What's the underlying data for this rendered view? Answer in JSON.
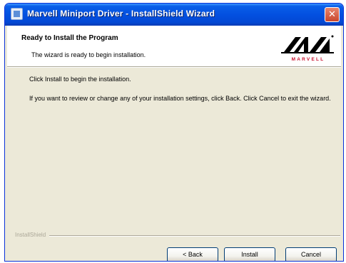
{
  "window": {
    "title": "Marvell Miniport Driver - InstallShield Wizard",
    "close_glyph": "✕"
  },
  "header": {
    "title": "Ready to Install the Program",
    "subtitle": "The wizard is ready to begin installation.",
    "logo_text": "MARVELL"
  },
  "body": {
    "line1": "Click Install to begin the installation.",
    "line2": "If you want to review or change any of your installation settings, click Back. Click Cancel to exit the wizard."
  },
  "footer": {
    "brand_label": "InstallShield"
  },
  "buttons": {
    "back": "< Back",
    "install": "Install",
    "cancel": "Cancel"
  },
  "colors": {
    "titlebar": "#0350e0",
    "dialog_face": "#ece9d8",
    "close_button": "#c9462c"
  },
  "icons": {
    "title_icon": "installer-icon",
    "close": "close-icon",
    "logo": "marvell-logo"
  }
}
